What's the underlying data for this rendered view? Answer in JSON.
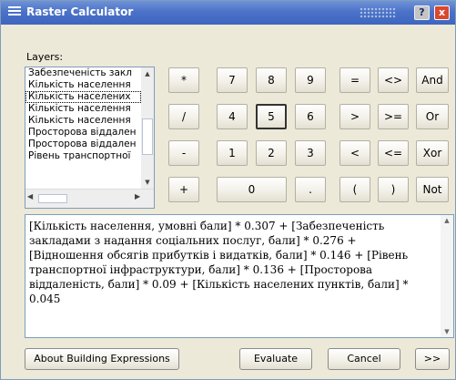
{
  "window": {
    "title": "Raster Calculator"
  },
  "titlebar": {
    "help_label": "?",
    "close_label": "x"
  },
  "layers": {
    "label": "Layers:",
    "items": [
      "Забезпеченість закл",
      "Кількість населення",
      "Кількість населених",
      "Кількість населення",
      "Кількість населення",
      "Просторова віддален",
      "Просторова віддален",
      "Рівень транспортної"
    ]
  },
  "keypad": {
    "ops": [
      "*",
      "/",
      "-",
      "+"
    ],
    "digits_row1": [
      "7",
      "8",
      "9"
    ],
    "digits_row2": [
      "4",
      "5",
      "6"
    ],
    "digits_row3": [
      "1",
      "2",
      "3"
    ],
    "zero": "0",
    "dot": ".",
    "compare_col1": [
      "=",
      ">",
      "<",
      "("
    ],
    "compare_col2": [
      "<>",
      ">=",
      "<=",
      ")"
    ],
    "logic": [
      "And",
      "Or",
      "Xor",
      "Not"
    ]
  },
  "expression": {
    "text": "[Кількість населення, умовні бали] * 0.307 + [Забезпеченість закладами з надання соціальних послуг, бали] * 0.276 + [Відношення обсягів прибутків і видатків, бали] * 0.146 + [Рівень транспортної інфраструктури, бали] * 0.136 + [Просторова віддаленість, бали] * 0.09 + [Кількість населених пунктів, бали] * 0.045"
  },
  "buttons": {
    "about": "About Building Expressions",
    "evaluate": "Evaluate",
    "cancel": "Cancel",
    "more": ">>"
  }
}
